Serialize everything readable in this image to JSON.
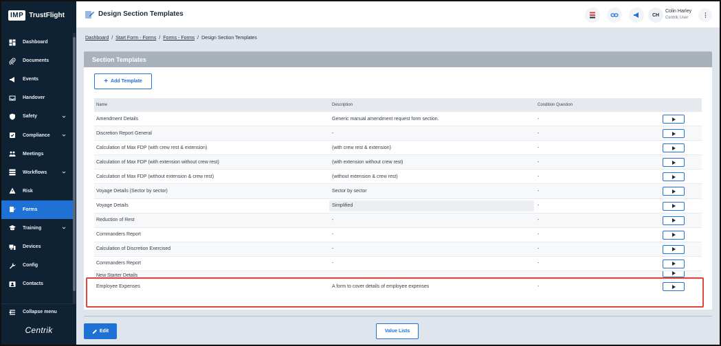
{
  "app": {
    "logo_badge": "IMP",
    "logo_name": "TrustFlight",
    "brand": "Centrik"
  },
  "sidebar": {
    "items": [
      {
        "label": "Dashboard",
        "icon": "dashboard-icon"
      },
      {
        "label": "Documents",
        "icon": "paperclip-icon"
      },
      {
        "label": "Events",
        "icon": "megaphone-icon"
      },
      {
        "label": "Handover",
        "icon": "inbox-icon"
      },
      {
        "label": "Safety",
        "icon": "shield-icon",
        "expandable": true
      },
      {
        "label": "Compliance",
        "icon": "checklist-icon",
        "expandable": true
      },
      {
        "label": "Meetings",
        "icon": "people-icon"
      },
      {
        "label": "Workflows",
        "icon": "workflow-icon",
        "expandable": true
      },
      {
        "label": "Risk",
        "icon": "warning-icon"
      },
      {
        "label": "Forms",
        "icon": "form-icon",
        "active": true
      },
      {
        "label": "Training",
        "icon": "graduation-icon",
        "expandable": true
      },
      {
        "label": "Devices",
        "icon": "devices-icon"
      },
      {
        "label": "Config",
        "icon": "wrench-icon"
      },
      {
        "label": "Contacts",
        "icon": "contacts-icon"
      }
    ],
    "collapse_label": "Collapse menu"
  },
  "header": {
    "title": "Design Section Templates",
    "user_name": "Colin Harley",
    "user_role": "Centrik User",
    "user_initials": "CH"
  },
  "breadcrumb": {
    "items": [
      "Dashboard",
      "Start Form - Forms",
      "Forms - Forms"
    ],
    "current": "Design Section Templates"
  },
  "card": {
    "title": "Section Templates",
    "add_label": "Add Template",
    "columns": {
      "name": "Name",
      "description": "Description",
      "condition": "Condition Question"
    },
    "rows": [
      {
        "name": "Amendment Details",
        "description": "Generic manual amendment request form section.",
        "condition": "-"
      },
      {
        "name": "Discretion Report General",
        "description": "-",
        "condition": "-"
      },
      {
        "name": "Calculation of Max FDP (with crew rest & extension)",
        "description": "(with crew rest & extension)",
        "condition": "-"
      },
      {
        "name": "Calculation of Max FDP (with extension without crew rest)",
        "description": "(with extension without crew rest)",
        "condition": "-"
      },
      {
        "name": "Calculation of Max FDP (without extension & crew rest)",
        "description": "(without extension & crew rest)",
        "condition": "-"
      },
      {
        "name": "Voyage Details (Sector by sector)",
        "description": "Sector by sector",
        "condition": "-"
      },
      {
        "name": "Voyage Details",
        "description": "Simplified",
        "condition": "-"
      },
      {
        "name": "Reduction of Rest",
        "description": "-",
        "condition": "-"
      },
      {
        "name": "Commanders Report",
        "description": "-",
        "condition": "-"
      },
      {
        "name": "Calculation of Discretion Exercised",
        "description": "-",
        "condition": "-"
      },
      {
        "name": "Commanders Report",
        "description": "-",
        "condition": "-"
      }
    ],
    "partial_row": {
      "name": "New Starter Details"
    },
    "highlighted_row": {
      "name": "Employee Expenses",
      "description": "A form to cover details of employee expenses",
      "condition": "-"
    }
  },
  "footer": {
    "edit_label": "Edit",
    "value_lists_label": "Value Lists"
  },
  "colors": {
    "primary": "#1f71d6",
    "sidebar": "#0f2233",
    "highlight": "#e0443f"
  }
}
